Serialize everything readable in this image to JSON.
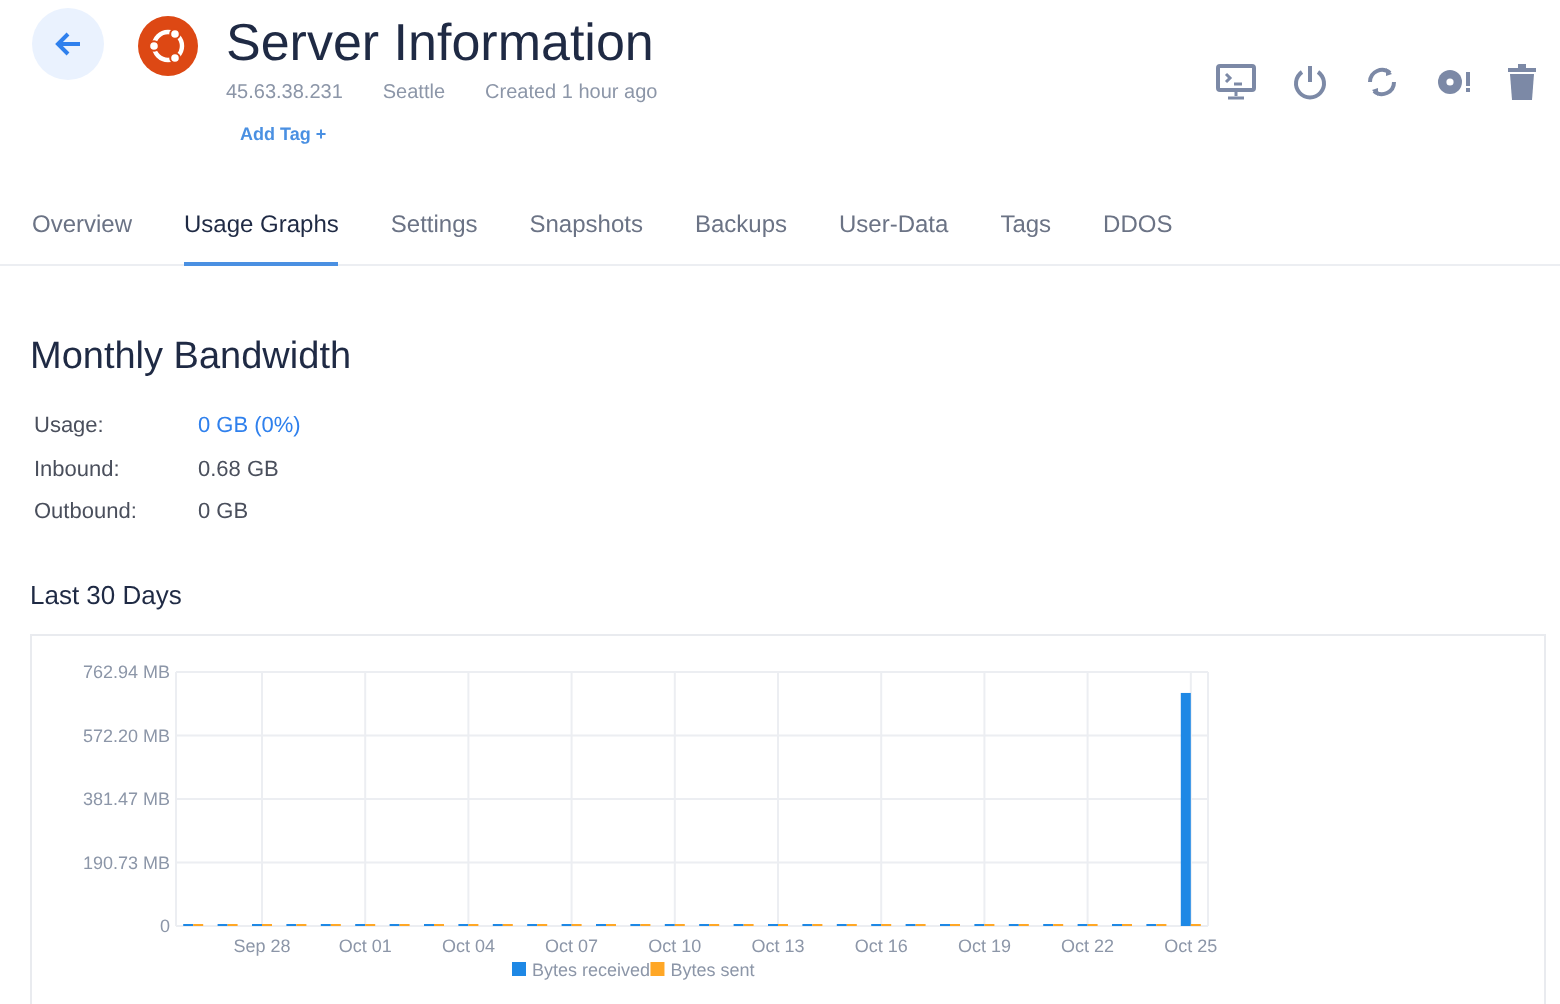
{
  "header": {
    "title": "Server Information",
    "ip": "45.63.38.231",
    "location": "Seattle",
    "created": "Created 1 hour ago",
    "add_tag": "Add Tag +"
  },
  "tabs": [
    {
      "label": "Overview",
      "selected": false
    },
    {
      "label": "Usage Graphs",
      "selected": true
    },
    {
      "label": "Settings",
      "selected": false
    },
    {
      "label": "Snapshots",
      "selected": false
    },
    {
      "label": "Backups",
      "selected": false
    },
    {
      "label": "User-Data",
      "selected": false
    },
    {
      "label": "Tags",
      "selected": false
    },
    {
      "label": "DDOS",
      "selected": false
    }
  ],
  "bandwidth": {
    "title": "Monthly Bandwidth",
    "rows": [
      {
        "label": "Usage:",
        "value": "0 GB (0%)",
        "kind": "link"
      },
      {
        "label": "Inbound:",
        "value": "0.68 GB",
        "kind": "plain"
      },
      {
        "label": "Outbound:",
        "value": "0 GB",
        "kind": "plain"
      }
    ]
  },
  "last_30_days": {
    "title": "Last 30 Days",
    "chart_data": {
      "type": "bar",
      "categories": [
        null,
        null,
        "Sep 28",
        null,
        null,
        "Oct 01",
        null,
        null,
        "Oct 04",
        null,
        null,
        "Oct 07",
        null,
        null,
        "Oct 10",
        null,
        null,
        "Oct 13",
        null,
        null,
        "Oct 16",
        null,
        null,
        "Oct 19",
        null,
        null,
        "Oct 22",
        null,
        null,
        "Oct 25"
      ],
      "grid": true,
      "legend": true,
      "series": [
        {
          "name": "Bytes received",
          "color": "#1e88e5",
          "values": [
            0,
            0,
            0,
            0,
            0,
            0,
            0,
            0,
            0,
            0,
            0,
            0,
            0,
            0,
            0,
            0,
            0,
            0,
            0,
            0,
            0,
            0,
            0,
            0,
            0,
            0,
            0,
            0,
            0,
            700
          ]
        },
        {
          "name": "Bytes sent",
          "color": "#ffa726",
          "values": [
            0,
            0,
            0,
            0,
            0,
            0,
            0,
            0,
            0,
            0,
            0,
            0,
            0,
            0,
            0,
            0,
            0,
            0,
            0,
            0,
            0,
            0,
            0,
            0,
            0,
            0,
            0,
            0,
            0,
            0
          ]
        }
      ],
      "ylim": [
        0,
        762.94
      ],
      "yticks": [
        {
          "value": 0,
          "label": "0"
        },
        {
          "value": 190.73,
          "label": "190.73 MB"
        },
        {
          "value": 381.47,
          "label": "381.47 MB"
        },
        {
          "value": 572.2,
          "label": "572.20 MB"
        },
        {
          "value": 762.94,
          "label": "762.94 MB"
        }
      ]
    }
  }
}
